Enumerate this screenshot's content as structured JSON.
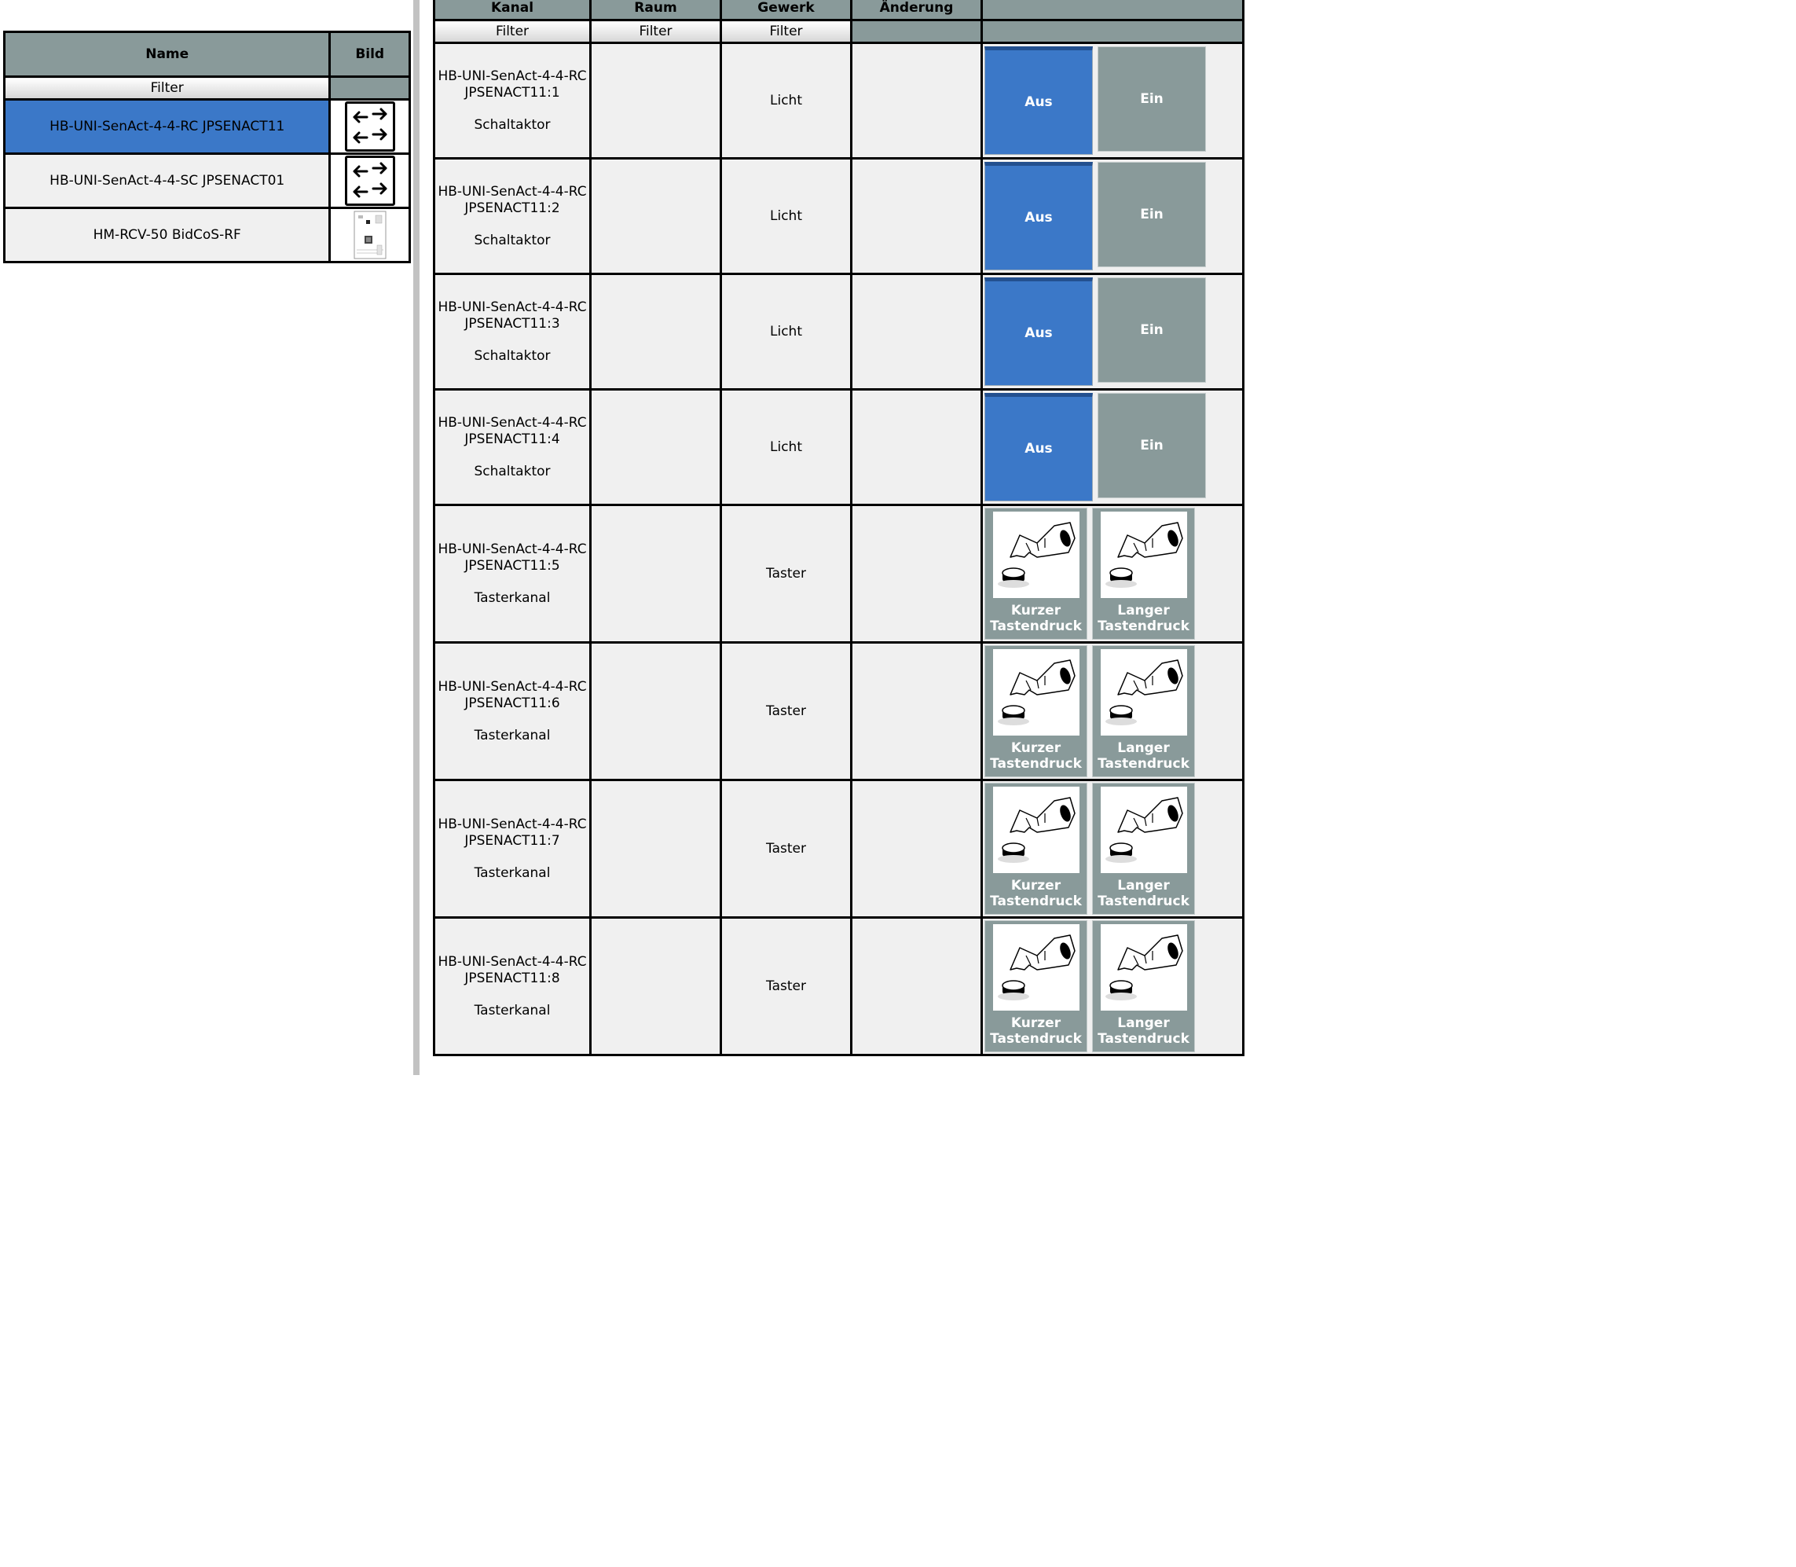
{
  "devices": {
    "headers": {
      "name": "Name",
      "image": "Bild"
    },
    "filter_label": "Filter",
    "rows": [
      {
        "name": "HB-UNI-SenAct-4-4-RC JPSENACT11",
        "icon": "arrows-icon",
        "selected": true
      },
      {
        "name": "HB-UNI-SenAct-4-4-SC JPSENACT01",
        "icon": "arrows-icon",
        "selected": false
      },
      {
        "name": "HM-RCV-50 BidCoS-RF",
        "icon": "board-icon",
        "selected": false
      }
    ]
  },
  "channels": {
    "headers": {
      "channel": "Kanal",
      "room": "Raum",
      "function": "Gewerk",
      "change": "Änderung",
      "control": ""
    },
    "filter_label": "Filter",
    "rows": [
      {
        "line1": "HB-UNI-SenAct-4-4-RC",
        "line2": "JPSENACT11:1",
        "type": "Schaltaktor",
        "room": "",
        "function": "Licht",
        "change": "",
        "btn_a": "Aus",
        "btn_b": "Ein"
      },
      {
        "line1": "HB-UNI-SenAct-4-4-RC",
        "line2": "JPSENACT11:2",
        "type": "Schaltaktor",
        "room": "",
        "function": "Licht",
        "change": "",
        "btn_a": "Aus",
        "btn_b": "Ein"
      },
      {
        "line1": "HB-UNI-SenAct-4-4-RC",
        "line2": "JPSENACT11:3",
        "type": "Schaltaktor",
        "room": "",
        "function": "Licht",
        "change": "",
        "btn_a": "Aus",
        "btn_b": "Ein"
      },
      {
        "line1": "HB-UNI-SenAct-4-4-RC",
        "line2": "JPSENACT11:4",
        "type": "Schaltaktor",
        "room": "",
        "function": "Licht",
        "change": "",
        "btn_a": "Aus",
        "btn_b": "Ein"
      },
      {
        "line1": "HB-UNI-SenAct-4-4-RC",
        "line2": "JPSENACT11:5",
        "type": "Tasterkanal",
        "room": "",
        "function": "Taster",
        "change": "",
        "short1": "Kurzer",
        "short2": "Tastendruck",
        "long1": "Langer",
        "long2": "Tastendruck"
      },
      {
        "line1": "HB-UNI-SenAct-4-4-RC",
        "line2": "JPSENACT11:6",
        "type": "Tasterkanal",
        "room": "",
        "function": "Taster",
        "change": "",
        "short1": "Kurzer",
        "short2": "Tastendruck",
        "long1": "Langer",
        "long2": "Tastendruck"
      },
      {
        "line1": "HB-UNI-SenAct-4-4-RC",
        "line2": "JPSENACT11:7",
        "type": "Tasterkanal",
        "room": "",
        "function": "Taster",
        "change": "",
        "short1": "Kurzer",
        "short2": "Tastendruck",
        "long1": "Langer",
        "long2": "Tastendruck"
      },
      {
        "line1": "HB-UNI-SenAct-4-4-RC",
        "line2": "JPSENACT11:8",
        "type": "Tasterkanal",
        "room": "",
        "function": "Taster",
        "change": "",
        "short1": "Kurzer",
        "short2": "Tastendruck",
        "long1": "Langer",
        "long2": "Tastendruck"
      }
    ]
  },
  "colors": {
    "header_gray": "#899a9a",
    "selection_blue": "#3b78c8",
    "cell_background": "#f0f0f0"
  }
}
